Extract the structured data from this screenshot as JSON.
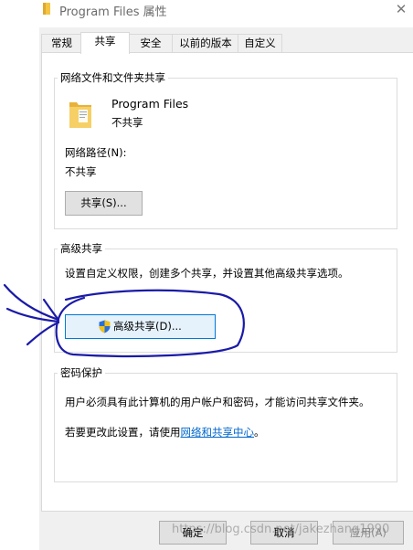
{
  "window": {
    "title": "Program Files 属性",
    "close_glyph": "✕"
  },
  "tabs": [
    {
      "label": "常规"
    },
    {
      "label": "共享"
    },
    {
      "label": "安全"
    },
    {
      "label": "以前的版本"
    },
    {
      "label": "自定义"
    }
  ],
  "network_group": {
    "title": "网络文件和文件夹共享",
    "folder_name": "Program Files",
    "folder_status": "不共享",
    "path_label": "网络路径(N):",
    "path_value": "不共享",
    "share_button": "共享(S)..."
  },
  "advanced_group": {
    "title": "高级共享",
    "description": "设置自定义权限，创建多个共享，并设置其他高级共享选项。",
    "advanced_button": "高级共享(D)..."
  },
  "password_group": {
    "title": "密码保护",
    "description": "用户必须具有此计算机的用户帐户和密码，才能访问共享文件夹。",
    "change_prefix": "若要更改此设置，请使用",
    "change_link": "网络和共享中心",
    "change_suffix": "。"
  },
  "footer": {
    "ok": "确定",
    "cancel": "取消",
    "apply": "应用(A)"
  },
  "watermark": "https://blog.csdn.net/jakezhang1990",
  "colors": {
    "annotation_ink": "#1a1aa8",
    "link": "#0066cc",
    "primary_border": "#0078d7"
  }
}
